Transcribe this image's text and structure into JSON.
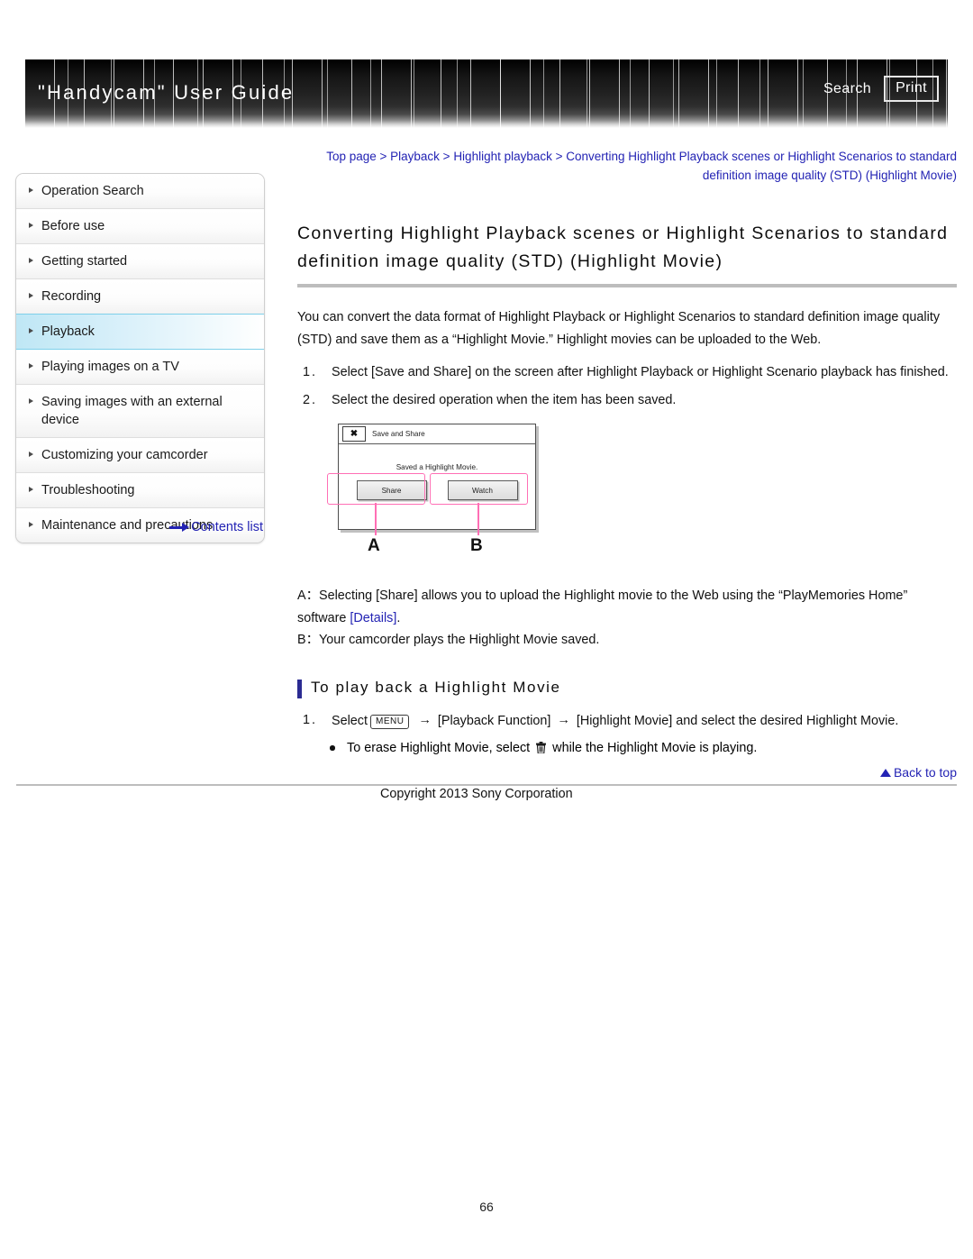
{
  "header": {
    "title": "\"Handycam\" User Guide",
    "search_label": "Search",
    "print_label": "Print"
  },
  "breadcrumb": {
    "items": [
      "Top page",
      "Playback",
      "Highlight playback",
      "Converting Highlight Playback scenes or Highlight Scenarios to standard definition image quality (STD) (Highlight Movie)"
    ],
    "separator": ">"
  },
  "sidebar": {
    "items": [
      {
        "label": "Operation Search",
        "active": false
      },
      {
        "label": "Before use",
        "active": false
      },
      {
        "label": "Getting started",
        "active": false
      },
      {
        "label": "Recording",
        "active": false
      },
      {
        "label": "Playback",
        "active": true
      },
      {
        "label": "Playing images on a TV",
        "active": false
      },
      {
        "label": "Saving images with an external device",
        "active": false
      },
      {
        "label": "Customizing your camcorder",
        "active": false
      },
      {
        "label": "Troubleshooting",
        "active": false
      },
      {
        "label": "Maintenance and precautions",
        "active": false
      }
    ],
    "contents_list_label": "Contents list"
  },
  "main": {
    "title": "Converting Highlight Playback scenes or Highlight Scenarios to standard definition image quality (STD) (Highlight Movie)",
    "intro": "You can convert the data format of Highlight Playback or Highlight Scenarios to standard definition image quality (STD) and save them as a “Highlight Movie.” Highlight movies can be uploaded to the Web.",
    "steps": [
      {
        "num": "1.",
        "text": "Select [Save and Share] on the screen after Highlight Playback or Highlight Scenario playback has finished."
      },
      {
        "num": "2.",
        "text": "Select the desired operation when the item has been saved."
      }
    ],
    "figure": {
      "dialog_title": "Save and Share",
      "close_icon": "close-x-icon",
      "message": "Saved a Highlight Movie.",
      "buttons": [
        {
          "label": "Share",
          "callout": "A"
        },
        {
          "label": "Watch",
          "callout": "B"
        }
      ],
      "callout_color": "#ff6fb5"
    },
    "callouts": {
      "a_prefix": "A：Selecting [Share] allows you to upload the Highlight movie to the Web using the “PlayMemories Home” software ",
      "a_link": "[Details]",
      "a_suffix": ".",
      "b": "B：Your camcorder plays the Highlight Movie saved."
    },
    "subsection": {
      "heading": "To play back a Highlight Movie",
      "step_num": "1.",
      "step_prefix": "Select",
      "menu_icon_label": "MENU",
      "step_mid1": "[Playback Function]",
      "step_mid2": "[Highlight Movie] and select the desired Highlight Movie.",
      "arrow": "→",
      "bullet_prefix": "To erase Highlight Movie, select",
      "bullet_icon": "trash-icon",
      "bullet_suffix": "while the Highlight Movie is playing."
    }
  },
  "footer": {
    "back_to_top": "Back to top",
    "copyright": "Copyright 2013 Sony Corporation",
    "page_number": "66"
  },
  "colors": {
    "link": "#2323b4",
    "accent_bar": "#2b2b92",
    "active_item": "#bfe7f5",
    "callout_pink": "#ff6fb5"
  }
}
